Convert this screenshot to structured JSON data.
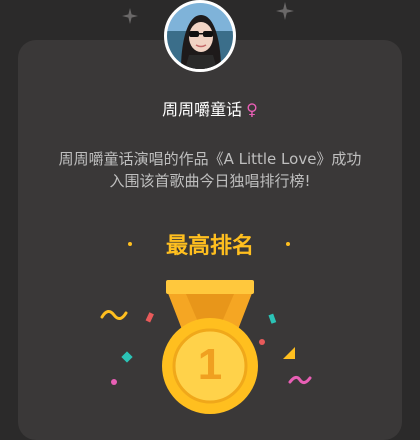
{
  "user": {
    "name": "周周嚼童话",
    "gender_symbol": "♀"
  },
  "message": {
    "line1": "周周嚼童话演唱的作品《A Little Love》成功",
    "line2": "入围该首歌曲今日独唱排行榜!"
  },
  "rank": {
    "title": "最高排名",
    "position": "1"
  },
  "colors": {
    "background": "#2b2a2a",
    "card": "#3a3838",
    "accent": "#ffbf1f",
    "gender": "#e85fb5"
  },
  "icons": [
    "sparkle-icon",
    "medal-icon",
    "confetti-icon"
  ]
}
